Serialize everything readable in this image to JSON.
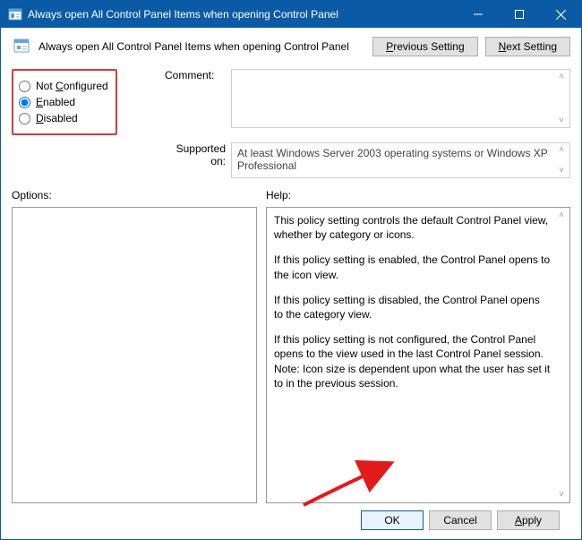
{
  "window": {
    "title": "Always open All Control Panel Items when opening Control Panel"
  },
  "header": {
    "title": "Always open All Control Panel Items when opening Control Panel",
    "prev_btn": "Previous Setting",
    "next_btn": "Next Setting"
  },
  "state": {
    "not_configured": "Not Configured",
    "enabled": "Enabled",
    "disabled": "Disabled"
  },
  "labels": {
    "comment": "Comment:",
    "supported": "Supported on:",
    "options": "Options:",
    "help": "Help:"
  },
  "supported_text": "At least Windows Server 2003 operating systems or Windows XP Professional",
  "help": {
    "p1": "This policy setting controls the default Control Panel view, whether by category or icons.",
    "p2": "If this policy setting is enabled, the Control Panel opens to the icon view.",
    "p3": "If this policy setting is disabled, the Control Panel opens to the category view.",
    "p4": "If this policy setting is not configured, the Control Panel opens to the view used in the last Control Panel session.",
    "p5": "Note: Icon size is dependent upon what the user has set it to in the previous session."
  },
  "footer": {
    "ok": "OK",
    "cancel": "Cancel",
    "apply": "Apply"
  }
}
